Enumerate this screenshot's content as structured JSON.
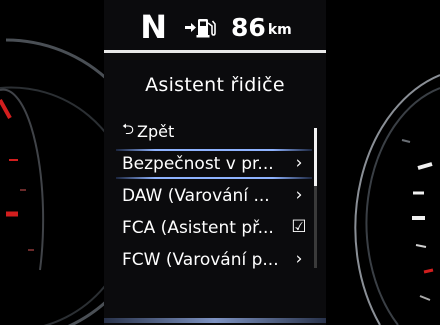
{
  "status": {
    "gear": "N",
    "fuel_icon": "fuel-pump-arrow-icon",
    "range_value": "86",
    "range_unit": "km"
  },
  "menu": {
    "title": "Asistent řidiče",
    "back_label": "Zpět",
    "back_icon": "return-arrow-icon",
    "items": [
      {
        "label": "Bezpečnost v pr...",
        "trail": "›",
        "trail_icon": "chevron-right-icon",
        "selected": true
      },
      {
        "label": "DAW (Varování ...",
        "trail": "›",
        "trail_icon": "chevron-right-icon",
        "selected": false
      },
      {
        "label": "FCA (Asistent př...",
        "trail": "☑",
        "trail_icon": "checkbox-checked-icon",
        "selected": false
      },
      {
        "label": "FCW (Varování p...",
        "trail": "›",
        "trail_icon": "chevron-right-icon",
        "selected": false
      }
    ]
  },
  "colors": {
    "background": "#000000",
    "text": "#ffffff",
    "selection_accent": "#8fb3ff",
    "gauge_red": "#d21e1e"
  }
}
